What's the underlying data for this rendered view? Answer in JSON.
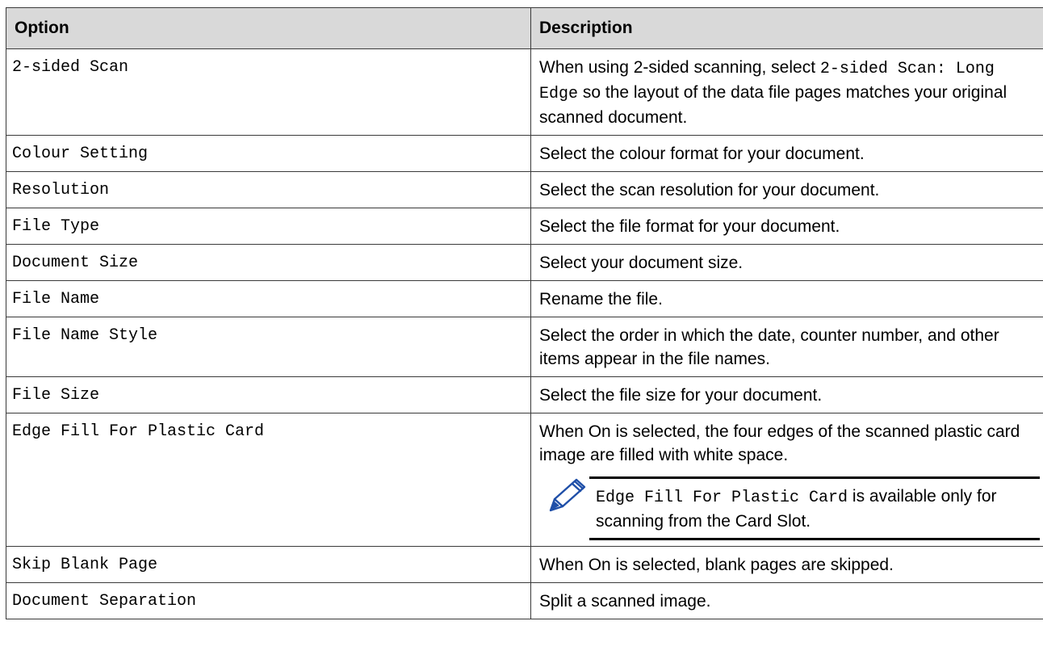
{
  "table": {
    "headers": [
      "Option",
      "Description"
    ],
    "rows": [
      {
        "option": "2-sided Scan",
        "desc_a": "When using 2-sided scanning, select ",
        "desc_code": "2-sided Scan: Long Edge",
        "desc_b": " so the layout of the data file pages matches your original scanned document."
      },
      {
        "option": "Colour Setting",
        "desc": "Select the colour format for your document."
      },
      {
        "option": "Resolution",
        "desc": "Select the scan resolution for your document."
      },
      {
        "option": "File Type",
        "desc": "Select the file format for your document."
      },
      {
        "option": "Document Size",
        "desc": "Select your document size."
      },
      {
        "option": "File Name",
        "desc": "Rename the file."
      },
      {
        "option": "File Name Style",
        "desc": "Select the order in which the date, counter number, and other items appear in the file names."
      },
      {
        "option": "File Size",
        "desc": "Select the file size for your document."
      },
      {
        "option": "Edge Fill For Plastic Card",
        "desc": "When On is selected, the four edges of the scanned plastic card image are filled with white space.",
        "note_code": "Edge Fill For Plastic Card",
        "note_text": " is available only for scanning from the Card Slot.",
        "note_icon": "pencil-icon"
      },
      {
        "option": "Skip Blank Page",
        "desc": "When On is selected, blank pages are skipped."
      },
      {
        "option": "Document Separation",
        "desc": "Split a scanned image."
      }
    ]
  }
}
